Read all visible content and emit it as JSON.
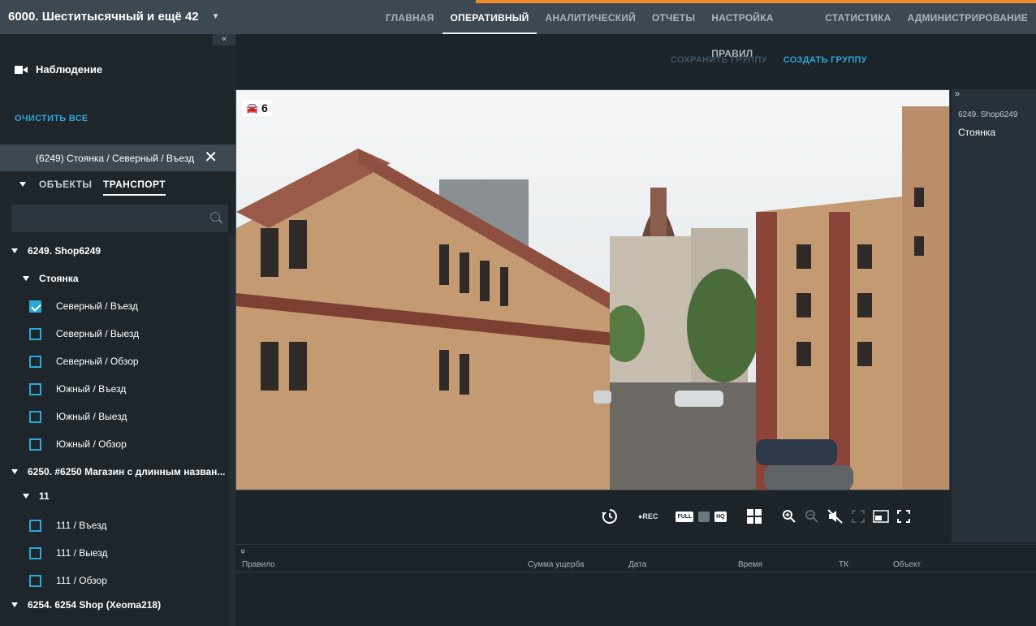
{
  "header": {
    "app_title": "6000. Шеститысячный и ещё 42",
    "nav": [
      "ГЛАВНАЯ",
      "ОПЕРАТИВНЫЙ",
      "АНАЛИТИЧЕСКИЙ",
      "ОТЧЕТЫ",
      "НАСТРОЙКА ПРАВИЛ",
      "СТАТИСТИКА",
      "АДМИНИСТРИРОВАНИЕ"
    ],
    "active_nav": "ОПЕРАТИВНЫЙ",
    "accent_color": "#f08a2c"
  },
  "sidebar": {
    "collapse_glyph": "«",
    "section_title": "Наблюдение",
    "clear_all": "ОЧИСТИТЬ ВСЕ",
    "selected_chip": "(6249) Стоянка / Северный / Въезд",
    "tabs": {
      "objects": "ОБЪЕКТЫ",
      "transport": "ТРАНСПОРТ"
    },
    "search_placeholder": "",
    "tree": [
      {
        "label": "6249. Shop6249",
        "kind": "group"
      },
      {
        "label": "Стоянка",
        "kind": "subgroup"
      },
      {
        "label": "Северный / Въезд",
        "kind": "camera",
        "checked": true
      },
      {
        "label": "Северный / Выезд",
        "kind": "camera",
        "checked": false
      },
      {
        "label": "Северный / Обзор",
        "kind": "camera",
        "checked": false
      },
      {
        "label": "Южный / Въезд",
        "kind": "camera",
        "checked": false
      },
      {
        "label": "Южный / Выезд",
        "kind": "camera",
        "checked": false
      },
      {
        "label": "Южный / Обзор",
        "kind": "camera",
        "checked": false
      },
      {
        "label": "6250. #6250 Магазин с длинным назван...",
        "kind": "group"
      },
      {
        "label": "11",
        "kind": "subgroup"
      },
      {
        "label": "111 / Въезд",
        "kind": "camera",
        "checked": false
      },
      {
        "label": "111 / Выезд",
        "kind": "camera",
        "checked": false
      },
      {
        "label": "111 / Обзор",
        "kind": "camera",
        "checked": false
      },
      {
        "label": "6254. 6254 Shop (Xeoma218)",
        "kind": "group"
      }
    ]
  },
  "main": {
    "save_group": "СОХРАНИТЬ ГРУППУ",
    "create_group": "СОЗДАТЬ ГРУППУ",
    "video": {
      "badge_icon": "car-icon",
      "badge_count": "6"
    },
    "controls": {
      "rec": "●REC",
      "full": "FULL",
      "hq": "HQ",
      "icons": [
        "history-icon",
        "record-indicator",
        "full-quality",
        "sd-quality",
        "hq-quality",
        "layout-grid-icon",
        "zoom-in-icon",
        "zoom-out-icon",
        "mute-icon",
        "expand-arrows-icon",
        "window-mode-icon",
        "fullscreen-icon"
      ]
    }
  },
  "right_panel": {
    "expand_glyph": "»",
    "title": "6249. Shop6249",
    "subtitle": "Стоянка"
  },
  "events": {
    "expand_glyph": "»",
    "columns": [
      "Правило",
      "Сумма ущерба",
      "Дата",
      "Время",
      "ТК",
      "Объект"
    ]
  }
}
